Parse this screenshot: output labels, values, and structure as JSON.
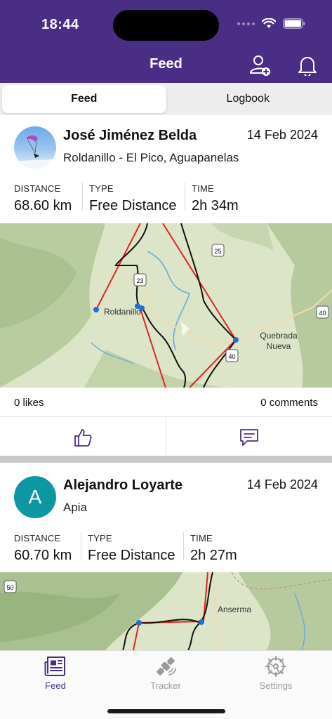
{
  "status": {
    "time": "18:44"
  },
  "header": {
    "title": "Feed",
    "add_friend_icon": "person-plus-icon",
    "bell_icon": "bell-icon"
  },
  "segment": {
    "tabs": [
      "Feed",
      "Logbook"
    ],
    "selected": "Feed"
  },
  "stat_labels": {
    "distance": "DISTANCE",
    "type": "TYPE",
    "time": "TIME"
  },
  "feed": [
    {
      "pilot": "José Jiménez Belda",
      "date": "14 Feb 2024",
      "location": "Roldanillo - El Pico, Aguapanelas",
      "distance": "68.60 km",
      "type": "Free Distance",
      "time": "2h 34m",
      "map_labels": {
        "town_1": "Roldanillo",
        "town_2": "Quebrada",
        "town_2b": "Nueva",
        "road_1": "23",
        "road_2": "25",
        "road_3": "40",
        "road_4": "40"
      },
      "likes": "0 likes",
      "comments": "0 comments"
    },
    {
      "pilot": "Alejandro Loyarte",
      "avatar_letter": "A",
      "date": "14 Feb 2024",
      "location": "Apia",
      "distance": "60.70 km",
      "type": "Free Distance",
      "time": "2h 27m",
      "map_labels": {
        "town_1": "Anserma",
        "road_1": "50"
      }
    }
  ],
  "tabbar": {
    "items": [
      {
        "label": "Feed",
        "icon": "newspaper-icon",
        "active": true
      },
      {
        "label": "Tracker",
        "icon": "satellite-icon",
        "active": false
      },
      {
        "label": "Settings",
        "icon": "gear-icon",
        "active": false
      }
    ]
  },
  "colors": {
    "primary": "#4a2e86",
    "track_red": "#e0231f",
    "track_black": "#111111",
    "avatar_teal": "#0c97a3"
  }
}
